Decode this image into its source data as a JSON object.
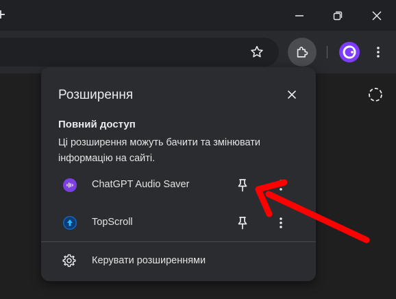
{
  "window": {
    "new_tab_glyph": "+",
    "controls": [
      "minimize-icon",
      "restore-icon",
      "close-icon"
    ]
  },
  "toolbar": {
    "icons": [
      "bookmark-star-icon",
      "extensions-puzzle-icon",
      "profile-avatar-icon",
      "menu-dots-icon"
    ]
  },
  "page": {
    "icons": [
      "screenshot-selection-icon"
    ]
  },
  "popup": {
    "title": "Розширення",
    "section_heading": "Повний доступ",
    "section_desc": "Ці розширення можуть бачити та змінювати інформацію на сайті.",
    "extensions": [
      {
        "name": "ChatGPT Audio Saver",
        "icon": "audio-wave-icon",
        "icon_color": "#7b3fe4"
      },
      {
        "name": "TopScroll",
        "icon": "up-arrow-icon",
        "icon_color": "#1565c0"
      }
    ],
    "manage_label": "Керувати розширеннями"
  },
  "annotation": {
    "arrow_color": "#ff0000"
  },
  "colors": {
    "background": "#1f1f1f",
    "toolbar": "#282a2d",
    "popup": "#2b2c2f",
    "accent": "#7d3cff"
  }
}
